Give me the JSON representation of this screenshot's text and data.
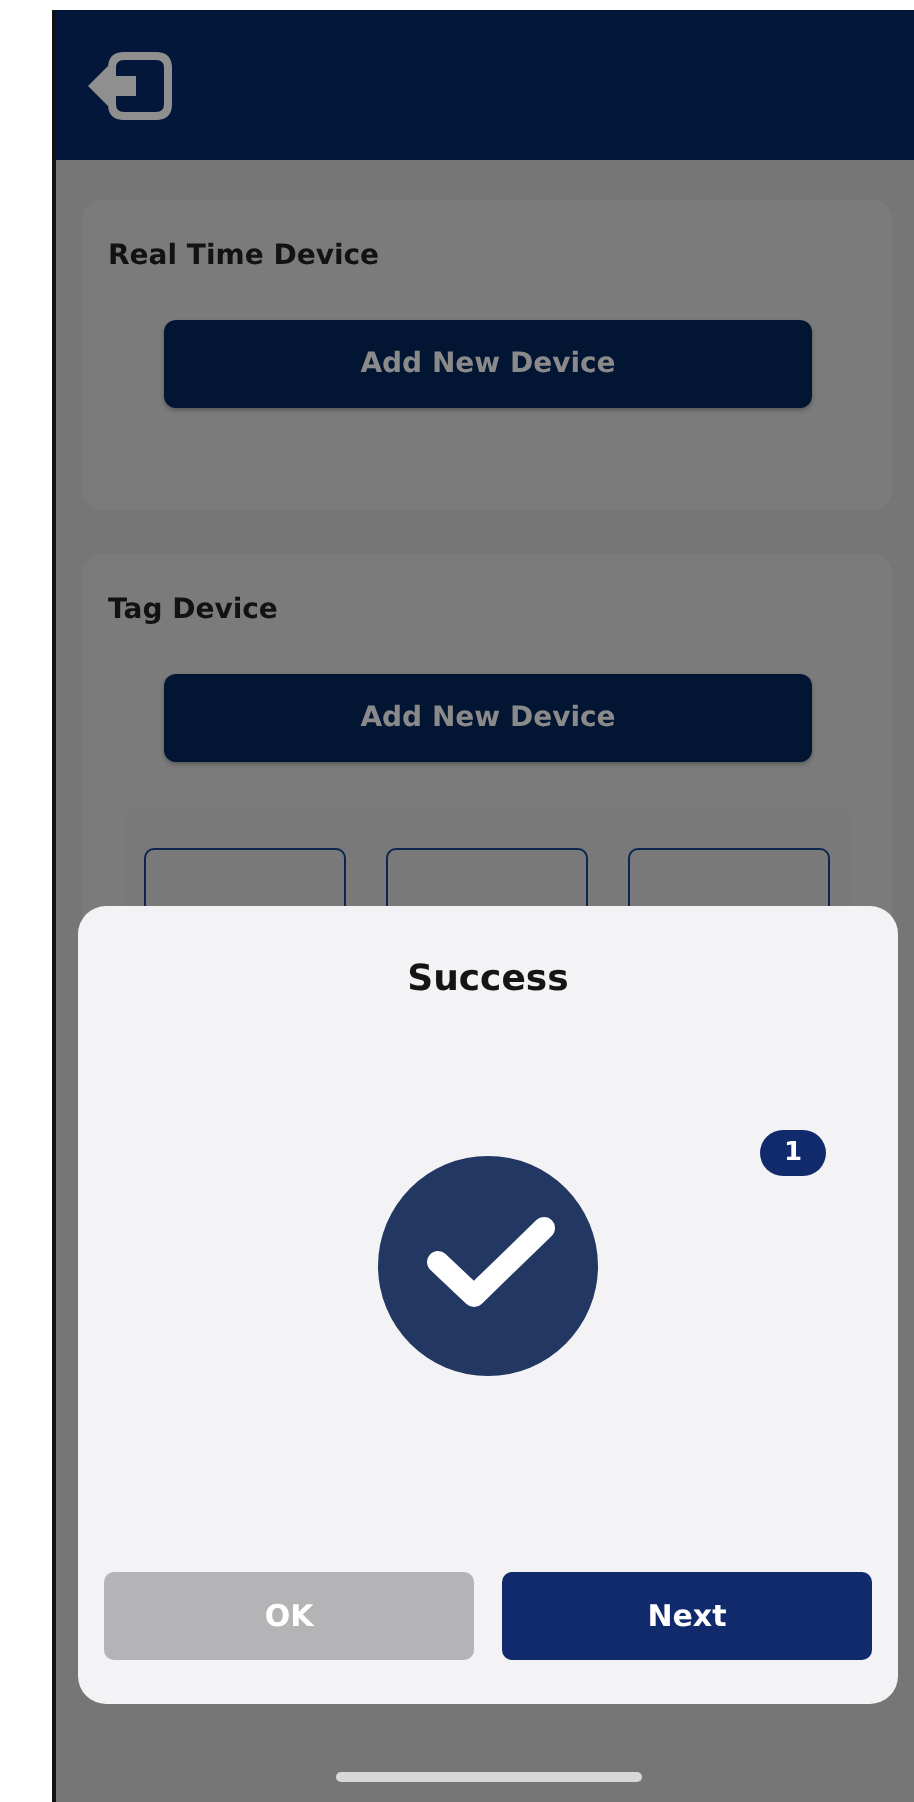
{
  "sections": [
    {
      "title": "Real Time Device",
      "button": "Add New Device"
    },
    {
      "title": "Tag Device",
      "button": "Add New Device"
    }
  ],
  "dialog": {
    "title": "Success",
    "badge": "1",
    "buttons": [
      {
        "label": "OK",
        "disabled": true
      },
      {
        "label": "Next",
        "disabled": false
      }
    ]
  }
}
